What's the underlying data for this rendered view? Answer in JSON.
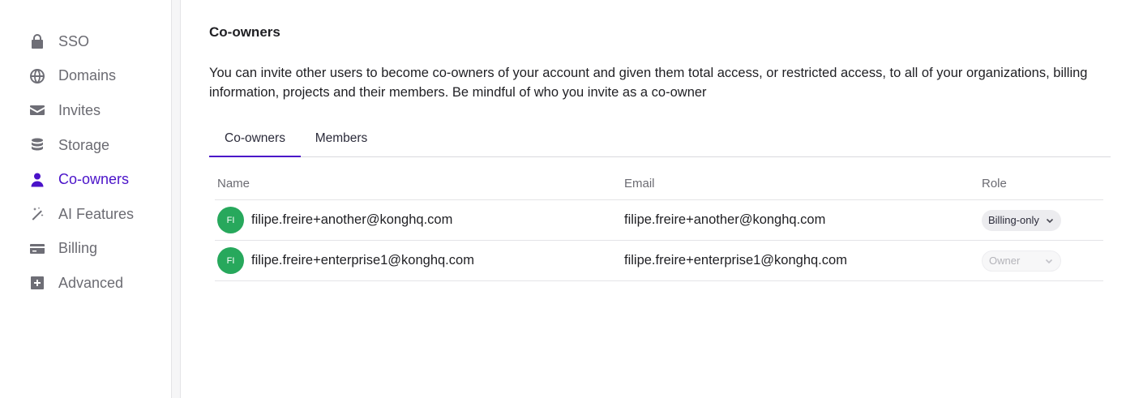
{
  "sidebar": {
    "items": [
      {
        "label": "SSO",
        "icon": "lock-icon",
        "active": false
      },
      {
        "label": "Domains",
        "icon": "globe-icon",
        "active": false
      },
      {
        "label": "Invites",
        "icon": "envelope-icon",
        "active": false
      },
      {
        "label": "Storage",
        "icon": "database-icon",
        "active": false
      },
      {
        "label": "Co-owners",
        "icon": "user-icon",
        "active": true
      },
      {
        "label": "AI Features",
        "icon": "magic-wand-icon",
        "active": false
      },
      {
        "label": "Billing",
        "icon": "credit-card-icon",
        "active": false
      },
      {
        "label": "Advanced",
        "icon": "plus-square-icon",
        "active": false
      }
    ]
  },
  "main": {
    "title": "Co-owners",
    "description": "You can invite other users to become co-owners of your account and given them total access, or restricted access, to all of your organizations, billing information, projects and their members. Be mindful of who you invite as a co-owner",
    "tabs": [
      {
        "label": "Co-owners",
        "active": true
      },
      {
        "label": "Members",
        "active": false
      }
    ],
    "table": {
      "headers": {
        "name": "Name",
        "email": "Email",
        "role": "Role"
      },
      "rows": [
        {
          "initials": "FI",
          "name": "filipe.freire+another@konghq.com",
          "email": "filipe.freire+another@konghq.com",
          "role": "Billing-only",
          "role_disabled": false
        },
        {
          "initials": "FI",
          "name": "filipe.freire+enterprise1@konghq.com",
          "email": "filipe.freire+enterprise1@konghq.com",
          "role": "Owner",
          "role_disabled": true
        }
      ]
    }
  },
  "colors": {
    "accent": "#4a12c9",
    "avatar": "#27a85c",
    "muted_text": "#6b6b72"
  }
}
